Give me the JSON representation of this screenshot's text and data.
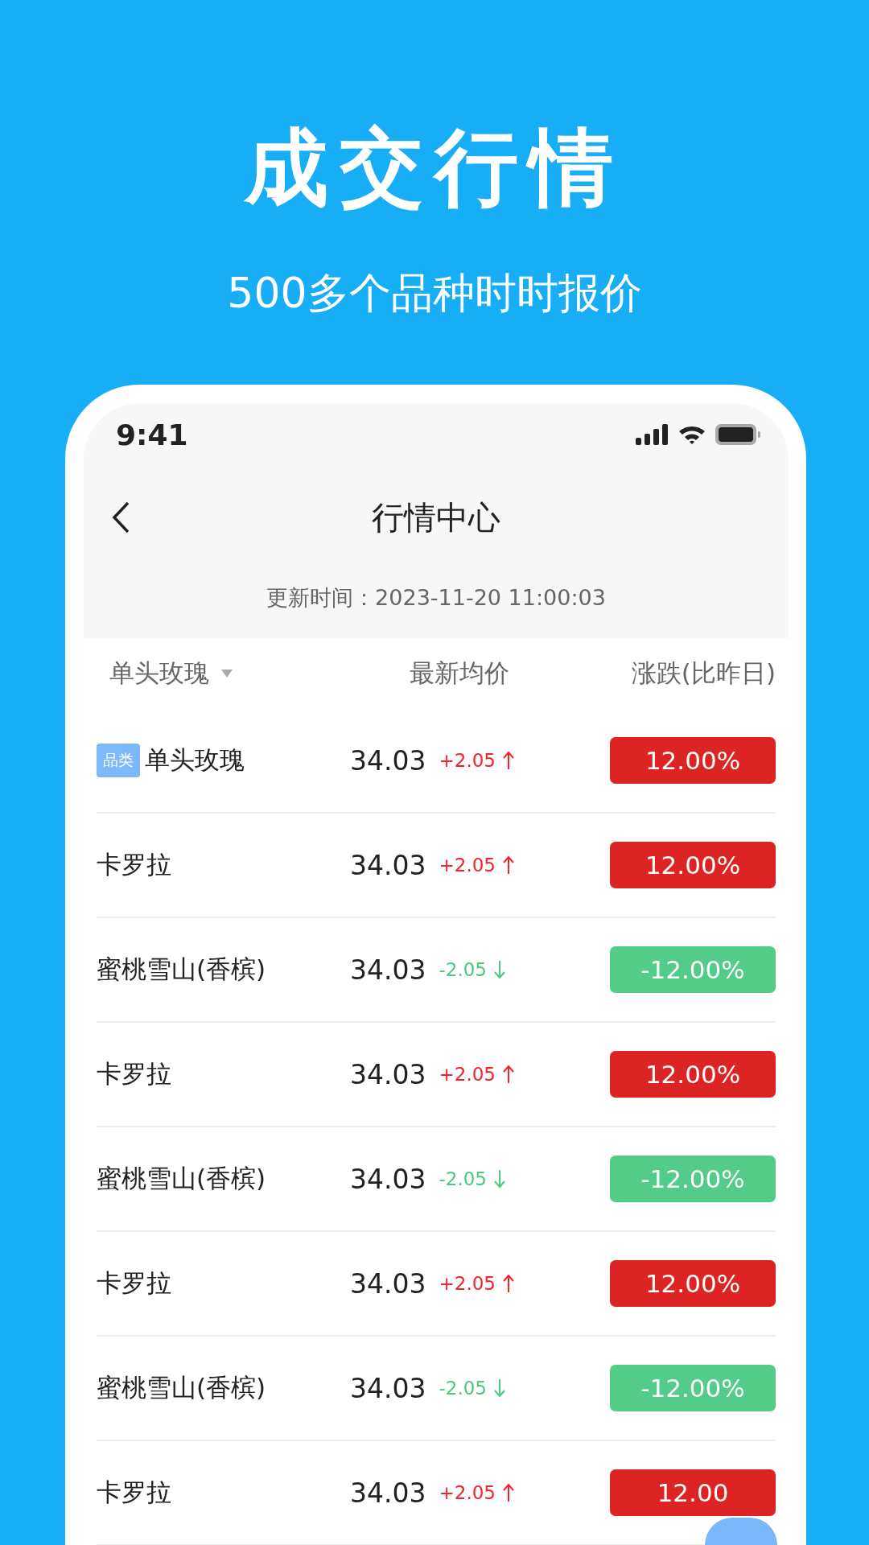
{
  "headline": "成交行情",
  "subtitle": "500多个品种时时报价",
  "status_bar": {
    "time": "9:41"
  },
  "nav": {
    "title": "行情中心"
  },
  "update_time": "更新时间：2023-11-20 11:00:03",
  "columns": [
    {
      "label": "单头玫瑰",
      "dropdown": true
    },
    {
      "label": "最新均价",
      "dropdown": false
    },
    {
      "label": "涨跌(比昨日)",
      "dropdown": false
    }
  ],
  "rows": [
    {
      "tag": "品类",
      "name": "单头玫瑰",
      "price": "34.03",
      "change": "+2.05",
      "kind": "up",
      "percent": "12.00%"
    },
    {
      "name": "卡罗拉",
      "price": "34.03",
      "change": "+2.05",
      "kind": "up",
      "percent": "12.00%"
    },
    {
      "name": "蜜桃雪山(香槟)",
      "price": "34.03",
      "change": "-2.05",
      "kind": "down",
      "percent": "-12.00%"
    },
    {
      "name": "卡罗拉",
      "price": "34.03",
      "change": "+2.05",
      "kind": "up",
      "percent": "12.00%"
    },
    {
      "name": "蜜桃雪山(香槟)",
      "price": "34.03",
      "change": "-2.05",
      "kind": "down",
      "percent": "-12.00%"
    },
    {
      "name": "卡罗拉",
      "price": "34.03",
      "change": "+2.05",
      "kind": "up",
      "percent": "12.00%"
    },
    {
      "name": "蜜桃雪山(香槟)",
      "price": "34.03",
      "change": "-2.05",
      "kind": "down",
      "percent": "-12.00%"
    },
    {
      "name": "卡罗拉",
      "price": "34.03",
      "change": "+2.05",
      "kind": "up",
      "percent": "12.00"
    }
  ]
}
